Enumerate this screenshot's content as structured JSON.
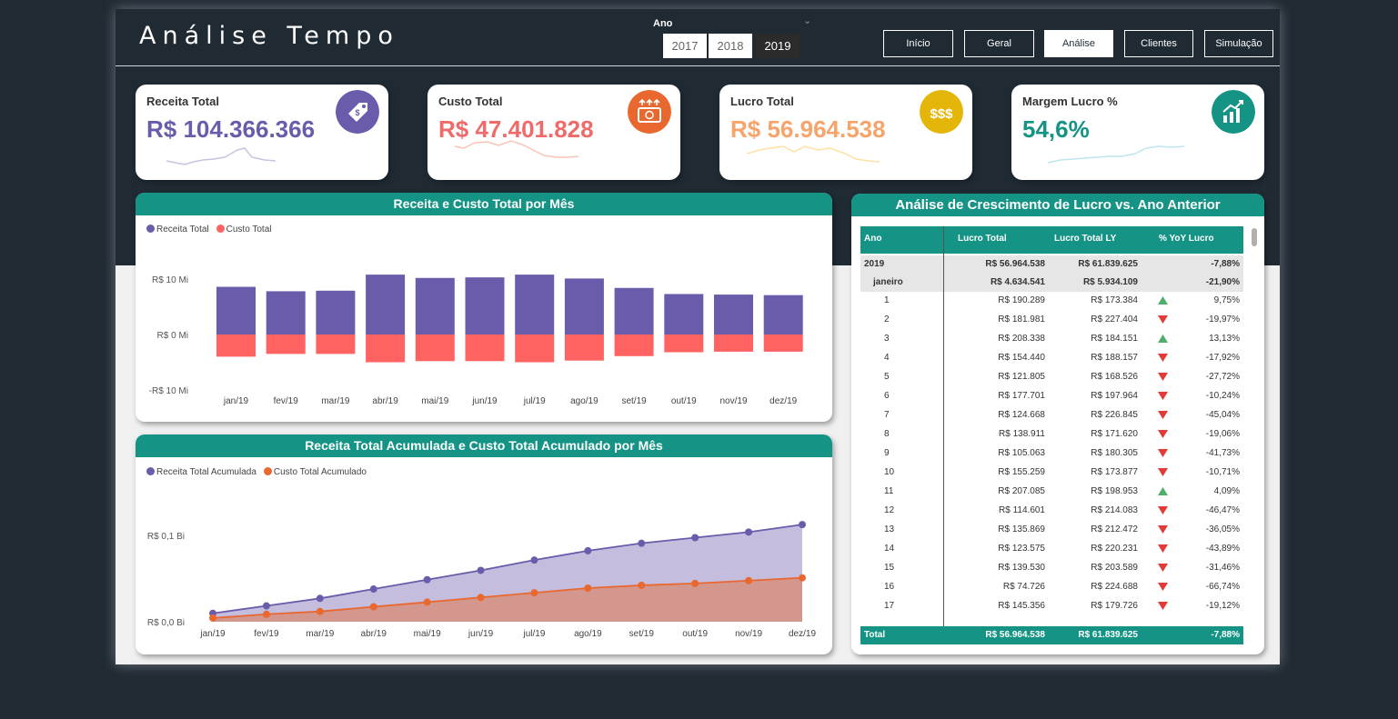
{
  "header": {
    "title": "Análise Tempo",
    "year_filter_label": "Ano",
    "years": [
      "2017",
      "2018",
      "2019"
    ],
    "selected_year": "2019",
    "nav": [
      "Início",
      "Geral",
      "Análise",
      "Clientes",
      "Simulação"
    ],
    "active_nav": "Análise"
  },
  "kpis": [
    {
      "label": "Receita Total",
      "value": "R$ 104.366.366",
      "color": "#6b5bab",
      "icon": "price-tag-icon",
      "icon_color": "#6b5bab",
      "icon_text": ""
    },
    {
      "label": "Custo Total",
      "value": "R$ 47.401.828",
      "color": "#f06a6a",
      "icon": "money-out-icon",
      "icon_color": "#e8682f",
      "icon_text": ""
    },
    {
      "label": "Lucro Total",
      "value": "R$ 56.964.538",
      "color": "#f7a46b",
      "icon": "dollar-icon",
      "icon_color": "#e5b60a",
      "icon_text": "$$$"
    },
    {
      "label": "Margem Lucro %",
      "value": "54,6%",
      "color": "#159486",
      "icon": "growth-chart-icon",
      "icon_color": "#159486",
      "icon_text": ""
    }
  ],
  "monthly_chart": {
    "title": "Receita e Custo Total por Mês",
    "legend": [
      "Receita Total",
      "Custo Total"
    ],
    "y_ticks": [
      "R$ 10 Mi",
      "R$ 0 Mi",
      "-R$ 10 Mi"
    ]
  },
  "cumulative_chart": {
    "title": "Receita Total Acumulada e Custo Total Acumulado por Mês",
    "legend": [
      "Receita Total Acumulada",
      "Custo Total Acumulado"
    ],
    "y_ticks": [
      "R$ 0,1 Bi",
      "R$ 0,0 Bi"
    ]
  },
  "chart_data": [
    {
      "type": "bar",
      "title": "Receita e Custo Total por Mês",
      "categories": [
        "jan/19",
        "fev/19",
        "mar/19",
        "abr/19",
        "mai/19",
        "jun/19",
        "jul/19",
        "ago/19",
        "set/19",
        "out/19",
        "nov/19",
        "dez/19"
      ],
      "series": [
        {
          "name": "Receita Total",
          "color": "#6b5bab",
          "values": [
            8.6,
            7.8,
            7.9,
            10.8,
            10.2,
            10.3,
            10.8,
            10.1,
            8.4,
            7.3,
            7.2,
            7.1
          ]
        },
        {
          "name": "Custo Total",
          "color": "#ff6361",
          "values": [
            -4.0,
            -3.5,
            -3.5,
            -5.0,
            -4.8,
            -4.8,
            -5.0,
            -4.7,
            -3.9,
            -3.2,
            -3.1,
            -3.1
          ]
        }
      ],
      "ylim": [
        -10,
        10
      ]
    },
    {
      "type": "area",
      "title": "Receita Total Acumulada e Custo Total Acumulado por Mês",
      "categories": [
        "jan/19",
        "fev/19",
        "mar/19",
        "abr/19",
        "mai/19",
        "jun/19",
        "jul/19",
        "ago/19",
        "set/19",
        "out/19",
        "nov/19",
        "dez/19"
      ],
      "series": [
        {
          "name": "Receita Total Acumulada",
          "color": "#6b5bab",
          "values": [
            0.009,
            0.017,
            0.025,
            0.035,
            0.045,
            0.055,
            0.066,
            0.076,
            0.084,
            0.09,
            0.096,
            0.104
          ]
        },
        {
          "name": "Custo Total Acumulado",
          "color": "#e8682f",
          "values": [
            0.004,
            0.008,
            0.011,
            0.016,
            0.021,
            0.026,
            0.031,
            0.036,
            0.039,
            0.041,
            0.044,
            0.047
          ]
        }
      ],
      "ylim": [
        0,
        0.11
      ]
    }
  ],
  "growth_table": {
    "title": "Análise de Crescimento de Lucro vs. Ano Anterior",
    "columns": [
      "Ano",
      "Lucro Total",
      "Lucro Total LY",
      "% YoY Lucro"
    ],
    "year_row": {
      "label": "2019",
      "lucro": "R$ 56.964.538",
      "lucro_ly": "R$ 61.839.625",
      "yoy": "-7,88%"
    },
    "month_row": {
      "label": "janeiro",
      "lucro": "R$ 4.634.541",
      "lucro_ly": "R$ 5.934.109",
      "yoy": "-21,90%"
    },
    "rows": [
      {
        "day": "1",
        "lucro": "R$ 190.289",
        "lucro_ly": "R$ 173.384",
        "trend": "up",
        "yoy": "9,75%"
      },
      {
        "day": "2",
        "lucro": "R$ 181.981",
        "lucro_ly": "R$ 227.404",
        "trend": "down",
        "yoy": "-19,97%"
      },
      {
        "day": "3",
        "lucro": "R$ 208.338",
        "lucro_ly": "R$ 184.151",
        "trend": "up",
        "yoy": "13,13%"
      },
      {
        "day": "4",
        "lucro": "R$ 154.440",
        "lucro_ly": "R$ 188.157",
        "trend": "down",
        "yoy": "-17,92%"
      },
      {
        "day": "5",
        "lucro": "R$ 121.805",
        "lucro_ly": "R$ 168.526",
        "trend": "down",
        "yoy": "-27,72%"
      },
      {
        "day": "6",
        "lucro": "R$ 177.701",
        "lucro_ly": "R$ 197.964",
        "trend": "down",
        "yoy": "-10,24%"
      },
      {
        "day": "7",
        "lucro": "R$ 124.668",
        "lucro_ly": "R$ 226.845",
        "trend": "down",
        "yoy": "-45,04%"
      },
      {
        "day": "8",
        "lucro": "R$ 138.911",
        "lucro_ly": "R$ 171.620",
        "trend": "down",
        "yoy": "-19,06%"
      },
      {
        "day": "9",
        "lucro": "R$ 105.063",
        "lucro_ly": "R$ 180.305",
        "trend": "down",
        "yoy": "-41,73%"
      },
      {
        "day": "10",
        "lucro": "R$ 155.259",
        "lucro_ly": "R$ 173.877",
        "trend": "down",
        "yoy": "-10,71%"
      },
      {
        "day": "11",
        "lucro": "R$ 207.085",
        "lucro_ly": "R$ 198.953",
        "trend": "up",
        "yoy": "4,09%"
      },
      {
        "day": "12",
        "lucro": "R$ 114.601",
        "lucro_ly": "R$ 214.083",
        "trend": "down",
        "yoy": "-46,47%"
      },
      {
        "day": "13",
        "lucro": "R$ 135.869",
        "lucro_ly": "R$ 212.472",
        "trend": "down",
        "yoy": "-36,05%"
      },
      {
        "day": "14",
        "lucro": "R$ 123.575",
        "lucro_ly": "R$ 220.231",
        "trend": "down",
        "yoy": "-43,89%"
      },
      {
        "day": "15",
        "lucro": "R$ 139.530",
        "lucro_ly": "R$ 203.589",
        "trend": "down",
        "yoy": "-31,46%"
      },
      {
        "day": "16",
        "lucro": "R$ 74.726",
        "lucro_ly": "R$ 224.688",
        "trend": "down",
        "yoy": "-66,74%"
      },
      {
        "day": "17",
        "lucro": "R$ 145.356",
        "lucro_ly": "R$ 179.726",
        "trend": "down",
        "yoy": "-19,12%"
      }
    ],
    "total": {
      "label": "Total",
      "lucro": "R$ 56.964.538",
      "lucro_ly": "R$ 61.839.625",
      "yoy": "-7,88%"
    }
  }
}
